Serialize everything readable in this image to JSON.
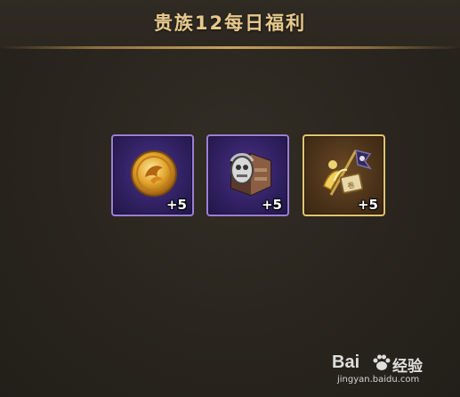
{
  "header": {
    "title": "贵族12每日福利"
  },
  "rewards": [
    {
      "icon": "gold-medallion-icon",
      "quantity": "+5",
      "rarity": "purple"
    },
    {
      "icon": "armored-cube-icon",
      "quantity": "+5",
      "rarity": "purple"
    },
    {
      "icon": "golden-banner-scroll-icon",
      "quantity": "+5",
      "rarity": "gold"
    }
  ],
  "watermark": {
    "brand": "Bai",
    "brand_tail": "经验",
    "url": "jingyan.baidu.com"
  },
  "colors": {
    "title": "#e7c98c",
    "purple_frame": "#9b7fd6",
    "gold_frame": "#e2c46f",
    "background": "#2a261f"
  }
}
